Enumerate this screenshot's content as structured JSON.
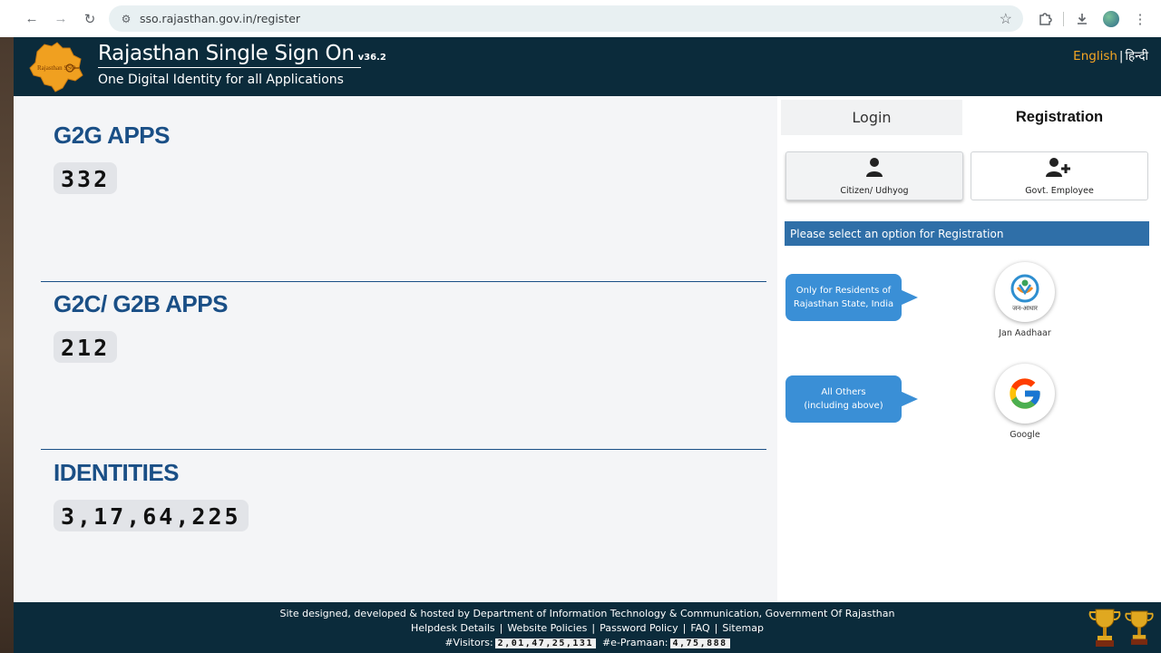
{
  "browser": {
    "url": "sso.rajasthan.gov.in/register"
  },
  "header": {
    "title": "Rajasthan Single Sign On",
    "version": "v36.2",
    "tagline": "One Digital Identity for all Applications",
    "lang_english": "English",
    "lang_separator": "|",
    "lang_hindi": "हिन्दी",
    "logo_text": "Rajasthan SSO"
  },
  "stats": [
    {
      "title": "G2G APPS",
      "count": "332"
    },
    {
      "title": "G2C/ G2B APPS",
      "count": "212"
    },
    {
      "title": "IDENTITIES",
      "count": "3,17,64,225"
    }
  ],
  "panel": {
    "tab_login": "Login",
    "tab_registration": "Registration",
    "option_citizen": "Citizen/ Udhyog",
    "option_govt": "Govt. Employee",
    "notice": "Please select an option for Registration",
    "bubble_residents": [
      "Only for Residents of",
      "Rajasthan State, India"
    ],
    "bubble_others": [
      "All Others",
      "(including above)"
    ],
    "jan_aadhaar_label": "Jan Aadhaar",
    "jan_aadhaar_logo_text": "जन-आधार",
    "google_label": "Google"
  },
  "footer": {
    "credit": "Site designed, developed & hosted by Department of Information Technology & Communication, Government Of Rajasthan",
    "links": [
      "Helpdesk Details",
      "Website Policies",
      "Password Policy",
      "FAQ",
      "Sitemap"
    ],
    "visitors_label": "#Visitors:",
    "visitors_value": "2,01,47,25,131",
    "epramaan_label": "#e-Pramaan:",
    "epramaan_value": "4,75,888"
  },
  "colors": {
    "header_bg": "#0b2b3b",
    "accent_blue": "#1a4f86",
    "notice_blue": "#2f6fa8",
    "bubble_blue": "#3a8fd6",
    "lang_orange": "#f5a623"
  }
}
